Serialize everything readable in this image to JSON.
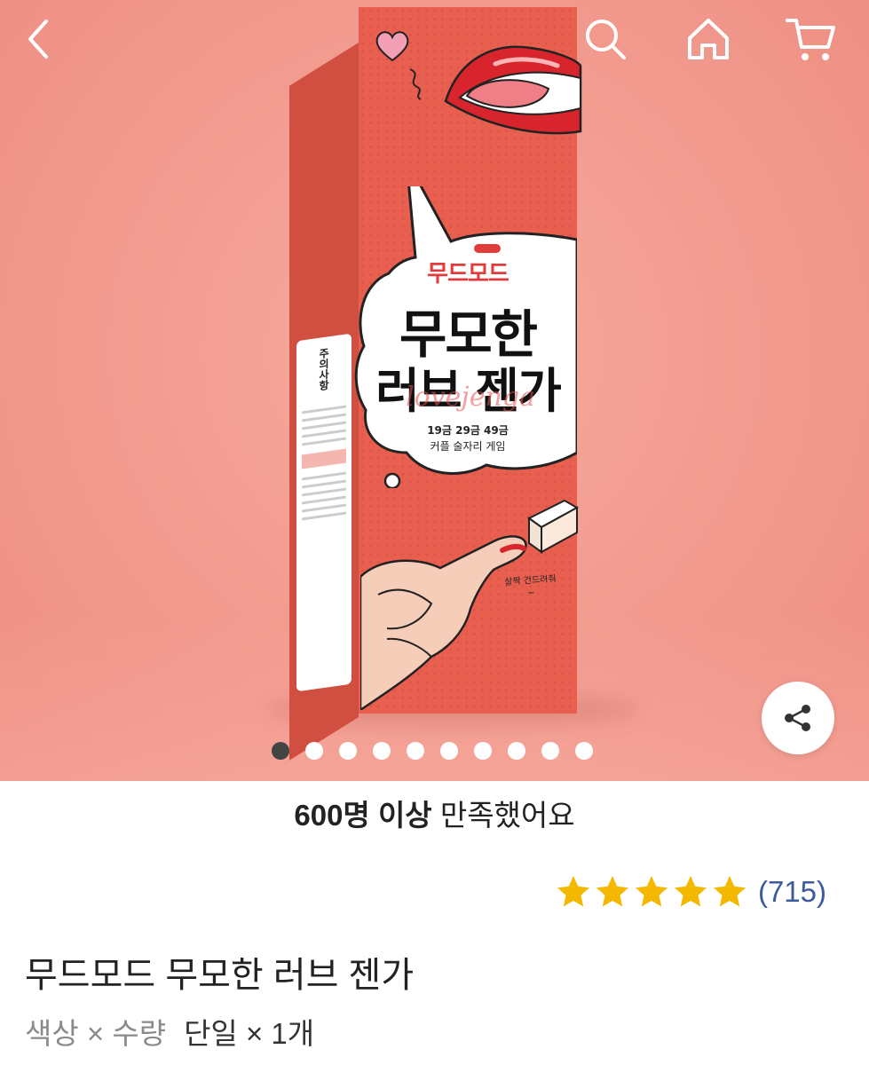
{
  "hero": {
    "box": {
      "brand": "무드모드",
      "title_line1": "무모한",
      "title_line2": "러브 젠가",
      "script_text": "lovejenga",
      "sub_line1": "19금 29금 49금",
      "sub_line2": "커플 술자리 게임",
      "side_label_title": "주의사항",
      "hand_note": "살짝 건드려줘~"
    },
    "carousel": {
      "total": 10,
      "active_index": 0
    }
  },
  "nav": {
    "back_icon": "chevron-left-icon",
    "search_icon": "search-icon",
    "home_icon": "home-icon",
    "cart_icon": "cart-icon"
  },
  "share": {
    "icon": "share-icon"
  },
  "satisfaction": {
    "strong": "600명 이상",
    "rest": " 만족했어요"
  },
  "rating": {
    "stars": 5,
    "star_color": "#f5b800",
    "review_count": "(715)"
  },
  "product": {
    "name": "무드모드 무모한 러브 젠가"
  },
  "option": {
    "label": "색상 × 수량",
    "value": "단일 × 1개"
  }
}
